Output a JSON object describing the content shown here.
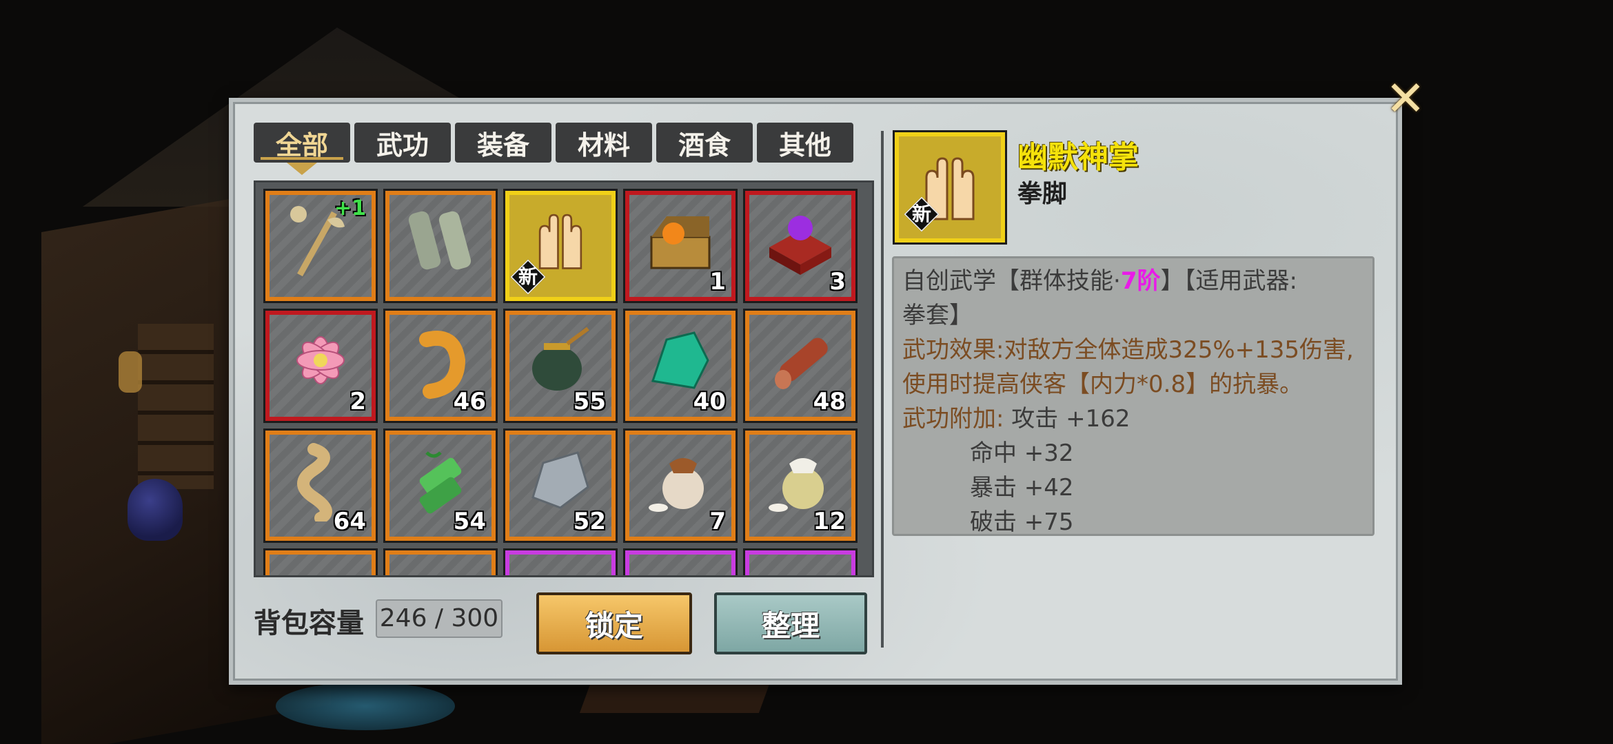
{
  "tabs": [
    "全部",
    "武功",
    "装备",
    "材料",
    "酒食",
    "其他"
  ],
  "active_tab": "全部",
  "items": [
    {
      "icon": "dragon-staff-icon",
      "quantity": "",
      "enhance": "+1",
      "rarity": "orange"
    },
    {
      "icon": "iron-bracers-icon",
      "quantity": "",
      "rarity": "orange"
    },
    {
      "icon": "palm-manual-icon",
      "quantity": "",
      "badge": "新",
      "rarity": "gold"
    },
    {
      "icon": "treasure-chest-orb-icon",
      "quantity": "1",
      "rarity": "red"
    },
    {
      "icon": "purple-orb-box-icon",
      "quantity": "3",
      "rarity": "red"
    },
    {
      "icon": "lotus-flower-icon",
      "quantity": "2",
      "rarity": "red"
    },
    {
      "icon": "grub-icon",
      "quantity": "46",
      "rarity": "orange"
    },
    {
      "icon": "honey-jar-icon",
      "quantity": "55",
      "rarity": "orange"
    },
    {
      "icon": "jade-stone-icon",
      "quantity": "40",
      "rarity": "orange"
    },
    {
      "icon": "wood-log-icon",
      "quantity": "48",
      "rarity": "orange"
    },
    {
      "icon": "rope-coil-icon",
      "quantity": "64",
      "rarity": "orange"
    },
    {
      "icon": "bamboo-icon",
      "quantity": "54",
      "rarity": "orange"
    },
    {
      "icon": "iron-ore-icon",
      "quantity": "52",
      "rarity": "orange"
    },
    {
      "icon": "wine-jar-icon",
      "quantity": "7",
      "rarity": "orange"
    },
    {
      "icon": "wine-jar-white-icon",
      "quantity": "12",
      "rarity": "orange"
    },
    {
      "icon": "item-icon",
      "quantity": "",
      "rarity": "orange"
    },
    {
      "icon": "item-icon",
      "quantity": "",
      "rarity": "orange"
    },
    {
      "icon": "item-icon",
      "quantity": "",
      "rarity": "purple"
    },
    {
      "icon": "item-icon",
      "quantity": "",
      "rarity": "purple"
    },
    {
      "icon": "item-icon",
      "quantity": "",
      "rarity": "purple"
    }
  ],
  "bag": {
    "label": "背包容量",
    "value": "246 / 300"
  },
  "buttons": {
    "lock": "锁定",
    "sort": "整理"
  },
  "close_icon": "close-icon",
  "detail": {
    "badge": "新",
    "name": "幽默神掌",
    "category": "拳脚",
    "line1_a": "自创武学【群体技能·",
    "line1_tier": "7阶",
    "line1_b": "】【适用武器:",
    "line2": "拳套】",
    "effect1": "武功效果:对敌方全体造成325%+135伤害,",
    "effect2": "使用时提高侠客【内力*0.8】的抗暴。",
    "bonus_label": "武功附加:",
    "bonus1": "攻击 +162",
    "bonus2": "命中 +32",
    "bonus3": "暴击 +42",
    "bonus4": "破击 +75"
  },
  "colors": {
    "orange": "#e07e18",
    "red": "#c0191f",
    "gold": "#f0d018",
    "purple": "#c83ce0",
    "name": "#f5e20b",
    "tier": "#e91be8"
  }
}
